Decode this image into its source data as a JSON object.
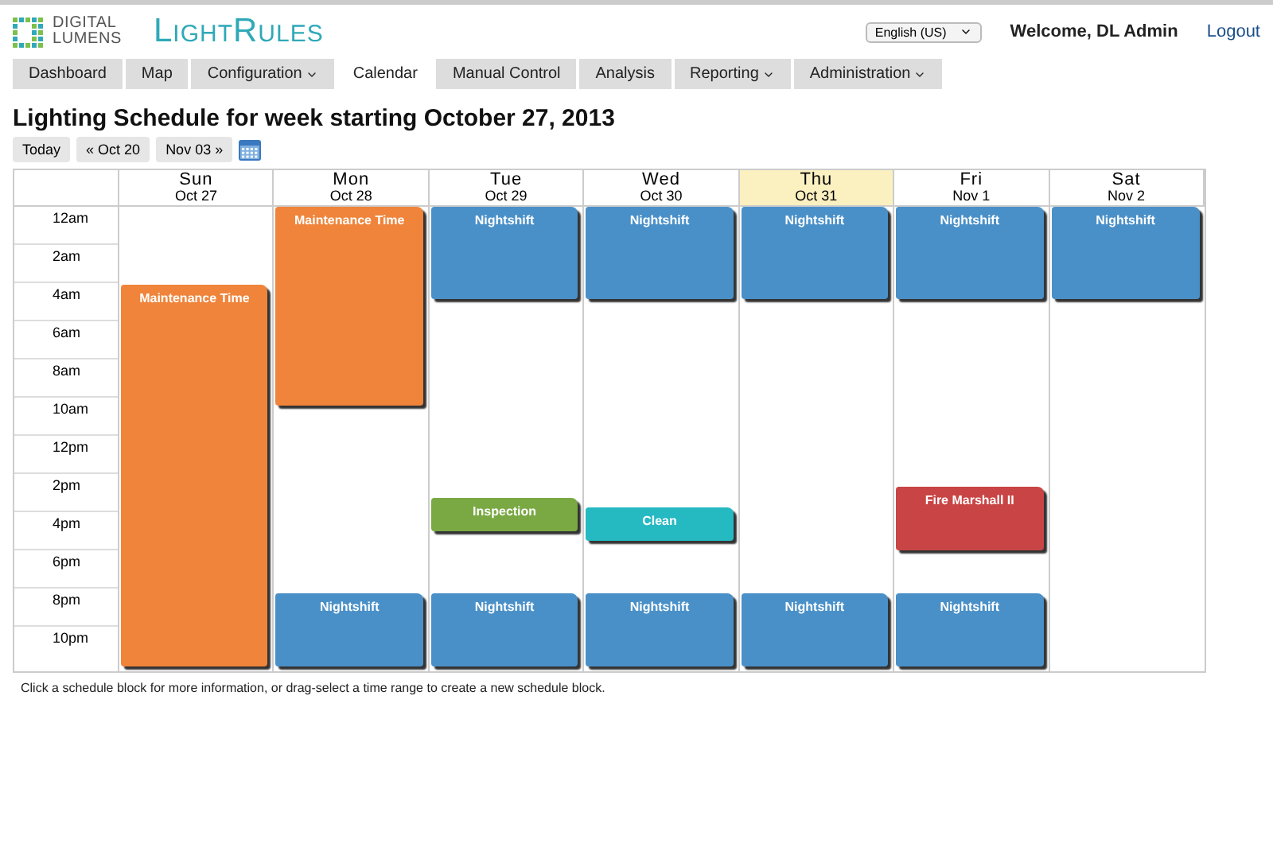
{
  "header": {
    "brand_lines": [
      "DIGITAL",
      "LUMENS"
    ],
    "product": "LightRules",
    "language": "English (US)",
    "welcome": "Welcome, DL Admin",
    "logout": "Logout"
  },
  "nav": [
    {
      "label": "Dashboard",
      "selected": false,
      "dropdown": false
    },
    {
      "label": "Map",
      "selected": false,
      "dropdown": false
    },
    {
      "label": "Configuration",
      "selected": false,
      "dropdown": true
    },
    {
      "label": "Calendar",
      "selected": true,
      "dropdown": false
    },
    {
      "label": "Manual Control",
      "selected": false,
      "dropdown": false
    },
    {
      "label": "Analysis",
      "selected": false,
      "dropdown": false
    },
    {
      "label": "Reporting",
      "selected": false,
      "dropdown": true
    },
    {
      "label": "Administration",
      "selected": false,
      "dropdown": true
    }
  ],
  "title": "Lighting Schedule for week starting October 27, 2013",
  "toolbar": {
    "today": "Today",
    "prev": "« Oct 20",
    "next": "Nov 03 »"
  },
  "calendar": {
    "hours": [
      "12am",
      "2am",
      "4am",
      "6am",
      "8am",
      "10am",
      "12pm",
      "2pm",
      "4pm",
      "6pm",
      "8pm",
      "10pm"
    ],
    "days": [
      {
        "name": "Sun",
        "date": "Oct 27",
        "today": false,
        "events": [
          {
            "title": "Maintenance Time",
            "color": "#ef843a"
          }
        ]
      },
      {
        "name": "Mon",
        "date": "Oct 28",
        "today": false,
        "events": [
          {
            "title": "Maintenance Time",
            "color": "#ef843a"
          },
          {
            "title": "Nightshift",
            "color": "#4a90c8"
          }
        ]
      },
      {
        "name": "Tue",
        "date": "Oct 29",
        "today": false,
        "events": [
          {
            "title": "Nightshift",
            "color": "#4a90c8"
          },
          {
            "title": "Inspection",
            "color": "#7aa843"
          },
          {
            "title": "Nightshift",
            "color": "#4a90c8"
          }
        ]
      },
      {
        "name": "Wed",
        "date": "Oct 30",
        "today": false,
        "events": [
          {
            "title": "Nightshift",
            "color": "#4a90c8"
          },
          {
            "title": "Clean",
            "color": "#25b9c2"
          },
          {
            "title": "Nightshift",
            "color": "#4a90c8"
          }
        ]
      },
      {
        "name": "Thu",
        "date": "Oct 31",
        "today": true,
        "events": [
          {
            "title": "Nightshift",
            "color": "#4a90c8"
          },
          {
            "title": "Nightshift",
            "color": "#4a90c8"
          }
        ]
      },
      {
        "name": "Fri",
        "date": "Nov 1",
        "today": false,
        "events": [
          {
            "title": "Nightshift",
            "color": "#4a90c8"
          },
          {
            "title": "Fire Marshall II",
            "color": "#c94444"
          },
          {
            "title": "Nightshift",
            "color": "#4a90c8"
          }
        ]
      },
      {
        "name": "Sat",
        "date": "Nov 2",
        "today": false,
        "events": [
          {
            "title": "Nightshift",
            "color": "#4a90c8"
          }
        ]
      }
    ]
  },
  "hint": "Click a schedule block for more information, or drag-select a time range to create a new schedule block."
}
